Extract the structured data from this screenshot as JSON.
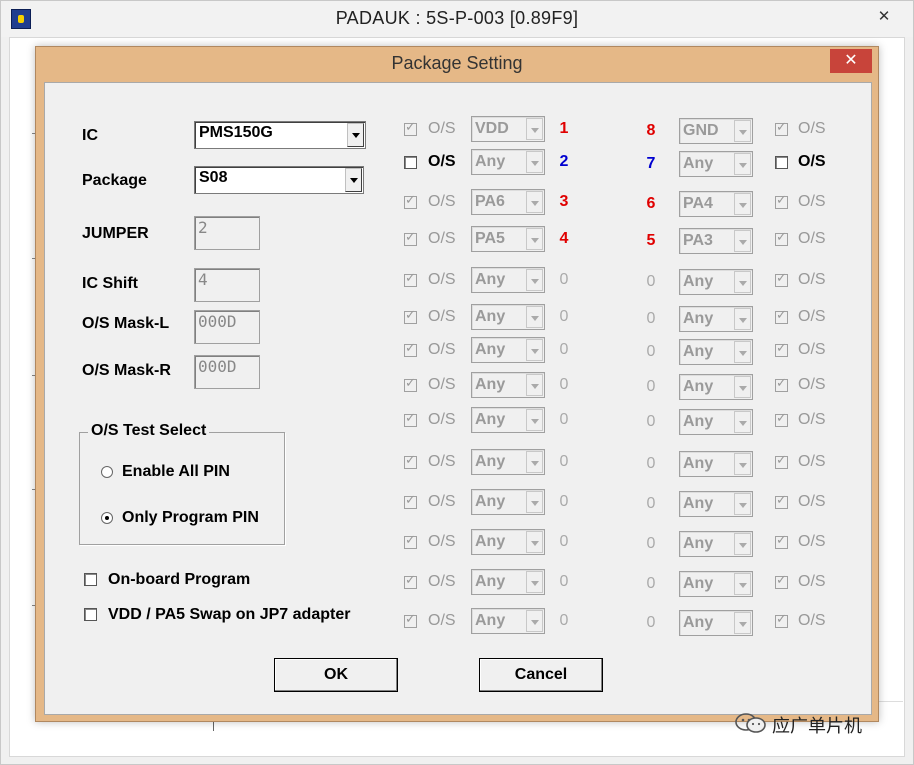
{
  "main_window": {
    "title": "PADAUK : 5S-P-003 [0.89F9]",
    "close_icon": "close-icon",
    "app_icon": "padauk-app-icon"
  },
  "dialog": {
    "title": "Package Setting",
    "close_icon": "close-icon",
    "close_color": "#c8443a",
    "frame_color": "#e5b887"
  },
  "form": {
    "ic_label": "IC",
    "ic_value": "PMS150G",
    "package_label": "Package",
    "package_value": "S08",
    "jumper_label": "JUMPER",
    "jumper_value": "2",
    "ic_shift_label": "IC Shift",
    "ic_shift_value": "4",
    "os_mask_l_label": "O/S Mask-L",
    "os_mask_l_value": "000D",
    "os_mask_r_label": "O/S Mask-R",
    "os_mask_r_value": "000D"
  },
  "os_test": {
    "legend": "O/S Test Select",
    "options": [
      {
        "label": "Enable All PIN",
        "selected": false
      },
      {
        "label": "Only Program PIN",
        "selected": true
      }
    ]
  },
  "checkboxes": {
    "onboard_label": "On-board Program",
    "onboard_checked": false,
    "swap_label": "VDD / PA5 Swap on JP7 adapter",
    "swap_checked": false
  },
  "pins_left": [
    {
      "os": "O/S",
      "enabled": false,
      "checked": true,
      "value": "VDD",
      "num": "1",
      "color": "red"
    },
    {
      "os": "O/S",
      "enabled": true,
      "checked": false,
      "value": "Any",
      "num": "2",
      "color": "blue"
    },
    {
      "os": "O/S",
      "enabled": false,
      "checked": true,
      "value": "PA6",
      "num": "3",
      "color": "red"
    },
    {
      "os": "O/S",
      "enabled": false,
      "checked": true,
      "value": "PA5",
      "num": "4",
      "color": "red"
    },
    {
      "os": "O/S",
      "enabled": false,
      "checked": true,
      "value": "Any",
      "num": "0",
      "color": "gray"
    },
    {
      "os": "O/S",
      "enabled": false,
      "checked": true,
      "value": "Any",
      "num": "0",
      "color": "gray"
    },
    {
      "os": "O/S",
      "enabled": false,
      "checked": true,
      "value": "Any",
      "num": "0",
      "color": "gray"
    },
    {
      "os": "O/S",
      "enabled": false,
      "checked": true,
      "value": "Any",
      "num": "0",
      "color": "gray"
    },
    {
      "os": "O/S",
      "enabled": false,
      "checked": true,
      "value": "Any",
      "num": "0",
      "color": "gray"
    },
    {
      "os": "O/S",
      "enabled": false,
      "checked": true,
      "value": "Any",
      "num": "0",
      "color": "gray"
    },
    {
      "os": "O/S",
      "enabled": false,
      "checked": true,
      "value": "Any",
      "num": "0",
      "color": "gray"
    },
    {
      "os": "O/S",
      "enabled": false,
      "checked": true,
      "value": "Any",
      "num": "0",
      "color": "gray"
    },
    {
      "os": "O/S",
      "enabled": false,
      "checked": true,
      "value": "Any",
      "num": "0",
      "color": "gray"
    },
    {
      "os": "O/S",
      "enabled": false,
      "checked": true,
      "value": "Any",
      "num": "0",
      "color": "gray"
    }
  ],
  "pins_right": [
    {
      "os": "O/S",
      "enabled": false,
      "checked": true,
      "value": "GND",
      "num": "8",
      "color": "red"
    },
    {
      "os": "O/S",
      "enabled": true,
      "checked": false,
      "value": "Any",
      "num": "7",
      "color": "blue"
    },
    {
      "os": "O/S",
      "enabled": false,
      "checked": true,
      "value": "PA4",
      "num": "6",
      "color": "red"
    },
    {
      "os": "O/S",
      "enabled": false,
      "checked": true,
      "value": "PA3",
      "num": "5",
      "color": "red"
    },
    {
      "os": "O/S",
      "enabled": false,
      "checked": true,
      "value": "Any",
      "num": "0",
      "color": "gray"
    },
    {
      "os": "O/S",
      "enabled": false,
      "checked": true,
      "value": "Any",
      "num": "0",
      "color": "gray"
    },
    {
      "os": "O/S",
      "enabled": false,
      "checked": true,
      "value": "Any",
      "num": "0",
      "color": "gray"
    },
    {
      "os": "O/S",
      "enabled": false,
      "checked": true,
      "value": "Any",
      "num": "0",
      "color": "gray"
    },
    {
      "os": "O/S",
      "enabled": false,
      "checked": true,
      "value": "Any",
      "num": "0",
      "color": "gray"
    },
    {
      "os": "O/S",
      "enabled": false,
      "checked": true,
      "value": "Any",
      "num": "0",
      "color": "gray"
    },
    {
      "os": "O/S",
      "enabled": false,
      "checked": true,
      "value": "Any",
      "num": "0",
      "color": "gray"
    },
    {
      "os": "O/S",
      "enabled": false,
      "checked": true,
      "value": "Any",
      "num": "0",
      "color": "gray"
    },
    {
      "os": "O/S",
      "enabled": false,
      "checked": true,
      "value": "Any",
      "num": "0",
      "color": "gray"
    },
    {
      "os": "O/S",
      "enabled": false,
      "checked": true,
      "value": "Any",
      "num": "0",
      "color": "gray"
    }
  ],
  "buttons": {
    "ok": "OK",
    "cancel": "Cancel"
  },
  "watermark": {
    "icon": "wechat-icon",
    "text": "应广单片机"
  }
}
